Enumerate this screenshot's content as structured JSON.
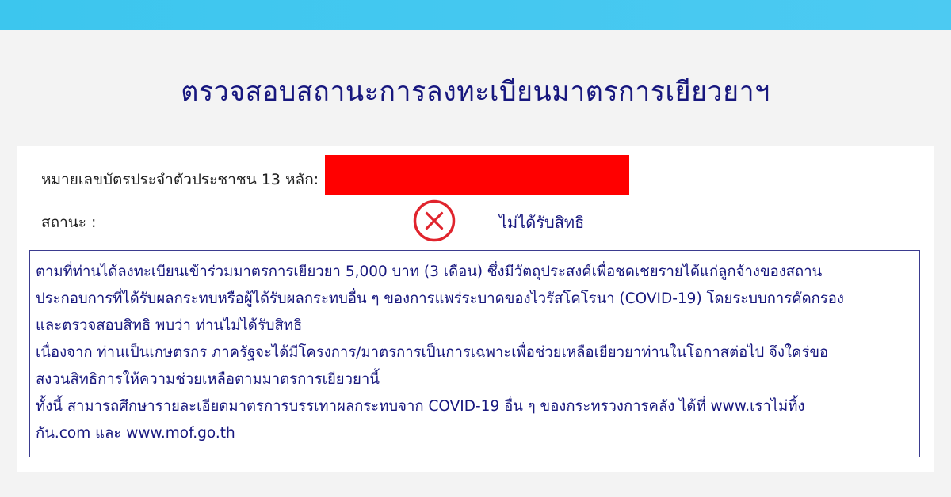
{
  "page_title": "ตรวจสอบสถานะการลงทะเบียนมาตรการเยียวยาฯ",
  "form": {
    "id_label": "หมายเลขบัตรประจำตัวประชาชน 13 หลัก:",
    "id_value": "",
    "status_label": "สถานะ :",
    "status_icon": "x-circle-icon",
    "status_text": "ไม่ได้รับสิทธิ"
  },
  "detail": {
    "lines": [
      "ตามที่ท่านได้ลงทะเบียนเข้าร่วมมาตรการเยียวยา 5,000 บาท (3 เดือน) ซึ่งมีวัตถุประสงค์เพื่อชดเชยรายได้แก่ลูกจ้างของสถาน",
      "ประกอบการที่ได้รับผลกระทบหรือผู้ได้รับผลกระทบอื่น ๆ ของการแพร่ระบาดของไวรัสโคโรนา (COVID-19) โดยระบบการคัดกรอง",
      "และตรวจสอบสิทธิ พบว่า ท่านไม่ได้รับสิทธิ",
      "เนื่องจาก ท่านเป็นเกษตรกร ภาครัฐจะได้มีโครงการ/มาตรการเป็นการเฉพาะเพื่อช่วยเหลือเยียวยาท่านในโอกาสต่อไป จึงใคร่ขอ",
      "สงวนสิทธิการให้ความช่วยเหลือตามมาตรการเยียวยานี้",
      "ทั้งนี้ สามารถศึกษารายละเอียดมาตรการบรรเทาผลกระทบจาก COVID-19 อื่น ๆ ของกระทรวงการคลัง ได้ที่ www.เราไม่ทิ้ง",
      "กัน.com และ www.mof.go.th"
    ]
  },
  "colors": {
    "top_bar": "#3cc6ee",
    "title": "#17177e",
    "redaction": "#ff0000",
    "status_icon": "#e0242d",
    "box_border": "#3b3b8f"
  }
}
